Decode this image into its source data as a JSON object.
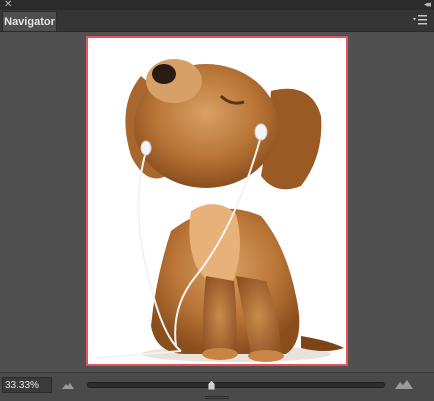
{
  "window": {
    "close_icon": "close-icon",
    "collapse_icon": "collapse-arrows-icon"
  },
  "panel": {
    "tab_label": "Navigator",
    "menu_icon": "panel-menu-icon"
  },
  "preview": {
    "image": "puppy with earphones",
    "view_box_color": "#e3555c"
  },
  "zoom": {
    "value": "33.33%",
    "slider_fraction": 0.42,
    "zoom_out_icon": "zoom-out-mountain-icon",
    "zoom_in_icon": "zoom-in-mountain-icon"
  }
}
